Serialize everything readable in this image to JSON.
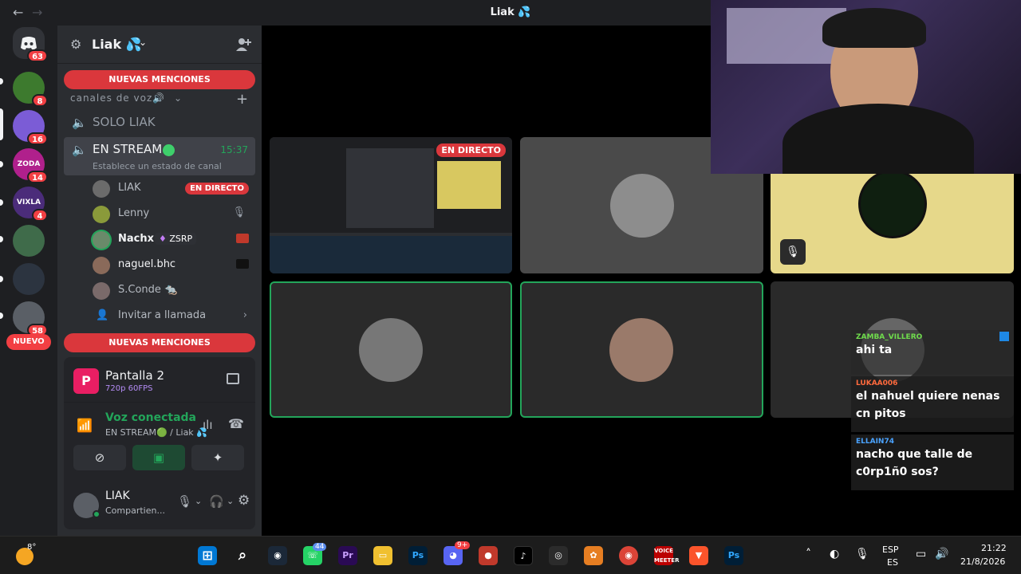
{
  "window": {
    "title": "Liak 💦"
  },
  "rail": {
    "home_badge": "63",
    "servers": [
      {
        "badge": "8",
        "color": "#3d7a2e"
      },
      {
        "badge": "16",
        "color": "#7b5cd6"
      },
      {
        "badge": "14",
        "color": "#b0208c",
        "label": "ZODA"
      },
      {
        "badge": "4",
        "color": "#4b2c7a",
        "label": "VIXLA"
      },
      {
        "badge": "",
        "color": "#3f6b4a"
      },
      {
        "badge": "",
        "color": "#2c3440"
      },
      {
        "badge": "58",
        "color": "#5a5f66"
      }
    ],
    "nuevo_label": "NUEVO"
  },
  "sidebar": {
    "guild_name": "Liak 💦",
    "mentions_label": "NUEVAS MENCIONES",
    "category": "canales de voz🔊",
    "channels": [
      {
        "name": "SOLO LIAK"
      },
      {
        "name": "EN STREAM",
        "time": "15:37",
        "status": "Establece un estado de canal"
      }
    ],
    "users": [
      {
        "name": "LIAK",
        "badge": "EN DIRECTO",
        "color": "#6b6b6b"
      },
      {
        "name": "Lenny",
        "color": "#8a9a3a"
      },
      {
        "name": "Nachx",
        "tag": "ZSRP",
        "color": "#6a8a6a"
      },
      {
        "name": "naguel.bhc",
        "color": "#8a6a5a"
      },
      {
        "name": "S.Conde 🐀",
        "color": "#7a6a6a"
      }
    ],
    "invite_label": "Invitar a llamada"
  },
  "stream_panel": {
    "title": "Pantalla 2",
    "quality": "720p 60FPS",
    "voice_status": "Voz conectada",
    "voice_channel": "EN STREAM🟢 / Liak 💦"
  },
  "user_panel": {
    "name": "LIAK",
    "status": "Compartien..."
  },
  "stage": {
    "live_badge": "EN DIRECTO",
    "tile_colors": [
      "#2b2d31",
      "#4a4a4a",
      "#e6d88a",
      "#2a2a2a",
      "#2a2a2a",
      "#2a2a2a"
    ]
  },
  "chat": [
    {
      "user": "ZAMBA_VILLERO",
      "color": "#6fdc4c",
      "message": "ahi ta"
    },
    {
      "user": "LUKAA006",
      "color": "#ff6a3d",
      "message": "el nahuel quiere nenas cn pitos"
    },
    {
      "user": "ELLAIN74",
      "color": "#4aa3ff",
      "message": "nacho que talle de c0rp1ñ0 sos?"
    }
  ],
  "taskbar": {
    "weather": "8°",
    "lang_top": "ESP",
    "lang_bottom": "ES",
    "time": "21:22",
    "date": "21/8/2026",
    "whatsapp_badge": "44",
    "discord_badge": "9+"
  }
}
